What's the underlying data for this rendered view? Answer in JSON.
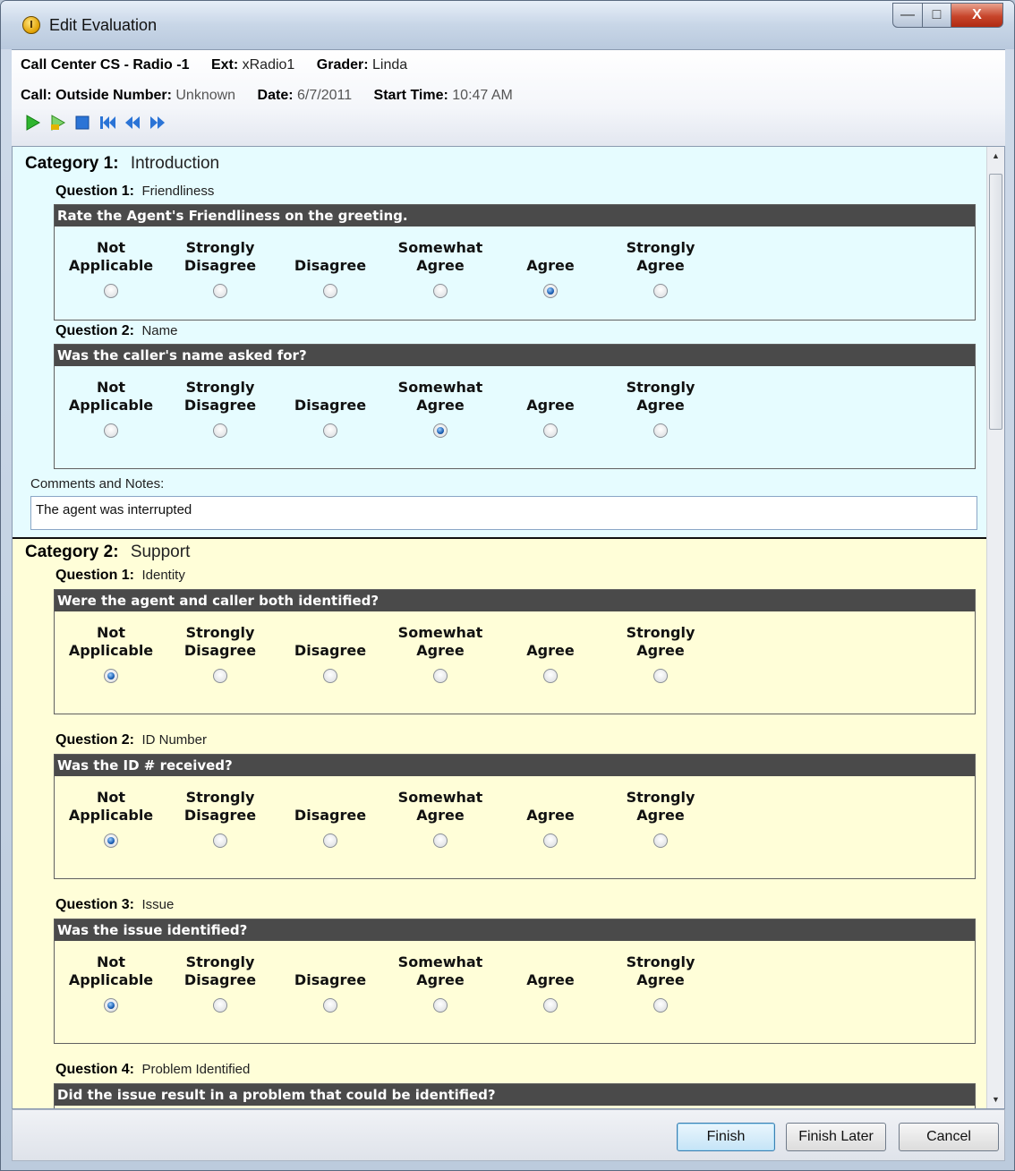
{
  "window": {
    "title": "Edit Evaluation",
    "min_glyph": "—",
    "max_glyph": "□",
    "close_glyph": "X"
  },
  "header": {
    "campaign": "Call Center CS - Radio -1",
    "ext_label": "Ext:",
    "ext_value": "xRadio1",
    "grader_label": "Grader:",
    "grader_value": "Linda",
    "call_label": "Call:",
    "outside_label": "Outside Number:",
    "outside_value": "Unknown",
    "date_label": "Date:",
    "date_value": "6/7/2011",
    "start_label": "Start Time:",
    "start_value": "10:47 AM"
  },
  "toolbar": [
    "play-icon",
    "play-selection-icon",
    "stop-icon",
    "skip-to-start-icon",
    "rewind-icon",
    "fast-forward-icon"
  ],
  "options": [
    {
      "line1": "Not",
      "line2": "Applicable"
    },
    {
      "line1": "Strongly",
      "line2": "Disagree"
    },
    {
      "line1": "",
      "line2": "Disagree"
    },
    {
      "line1": "Somewhat",
      "line2": "Agree"
    },
    {
      "line1": "",
      "line2": "Agree"
    },
    {
      "line1": "Strongly",
      "line2": "Agree"
    }
  ],
  "categories": [
    {
      "label": "Category 1:",
      "name": "Introduction",
      "questions": [
        {
          "label": "Question 1:",
          "name": "Friendliness",
          "text": "Rate the Agent's Friendliness on the greeting.",
          "selected": "Agree"
        },
        {
          "label": "Question 2:",
          "name": "Name",
          "text": "Was the caller's name asked for?",
          "selected": "Somewhat Agree"
        }
      ],
      "comments_label": "Comments and Notes:",
      "comments_value": "The agent was interrupted"
    },
    {
      "label": "Category 2:",
      "name": "Support",
      "questions": [
        {
          "label": "Question 1:",
          "name": "Identity",
          "text": "Were the agent and caller both identified?",
          "selected": "Not Applicable"
        },
        {
          "label": "Question 2:",
          "name": "ID Number",
          "text": "Was the ID # received?",
          "selected": "Not Applicable"
        },
        {
          "label": "Question 3:",
          "name": "Issue",
          "text": "Was the issue identified?",
          "selected": "Not Applicable"
        },
        {
          "label": "Question 4:",
          "name": "Problem Identified",
          "text": "Did the issue result in a problem that could be identified?",
          "selected": ""
        }
      ]
    }
  ],
  "footer": {
    "finish": "Finish",
    "finish_later": "Finish Later",
    "cancel": "Cancel"
  },
  "colors": {
    "category1_bg": "#e6fcff",
    "category2_bg": "#fffed8",
    "question_bar": "#4a4a4a"
  }
}
